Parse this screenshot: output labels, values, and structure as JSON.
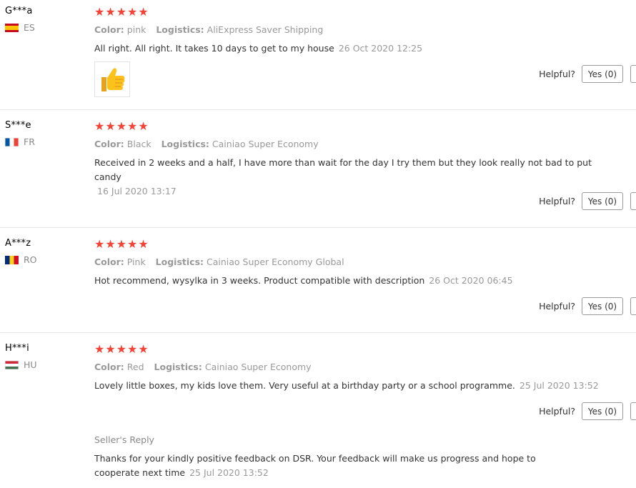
{
  "reviews": [
    {
      "user": "G***a",
      "country": "ES",
      "stars": "★★★★★",
      "color_label": "Color:",
      "color_value": "pink",
      "logistics_label": "Logistics:",
      "logistics_value": "AliExpress Saver Shipping",
      "text": "All right. All right. It takes 10 days to get to my house",
      "date": "26 Oct 2020 12:25",
      "helpful_label": "Helpful?",
      "yes_label": "Yes (0)",
      "photo_icon": "thumbs-up-icon"
    },
    {
      "user": "S***e",
      "country": "FR",
      "stars": "★★★★★",
      "color_label": "Color:",
      "color_value": "Black",
      "logistics_label": "Logistics:",
      "logistics_value": "Cainiao Super Economy",
      "text": "Received in 2 weeks and a half, I have more than wait for the day I try them but they look really not bad to put candy",
      "date": "16 Jul 2020 13:17",
      "helpful_label": "Helpful?",
      "yes_label": "Yes (0)"
    },
    {
      "user": "A***z",
      "country": "RO",
      "stars": "★★★★★",
      "color_label": "Color:",
      "color_value": "Pink",
      "logistics_label": "Logistics:",
      "logistics_value": "Cainiao Super Economy Global",
      "text": "Hot recommend, wysylka in 3 weeks. Product compatible with description",
      "date": "26 Oct 2020 06:45",
      "helpful_label": "Helpful?",
      "yes_label": "Yes (0)"
    },
    {
      "user": "H***i",
      "country": "HU",
      "stars": "★★★★★",
      "color_label": "Color:",
      "color_value": "Red",
      "logistics_label": "Logistics:",
      "logistics_value": "Cainiao Super Economy",
      "text": "Lovely little boxes, my kids love them. Very useful at a birthday party or a school programme.",
      "date": "25 Jul 2020 13:52",
      "helpful_label": "Helpful?",
      "yes_label": "Yes (0)",
      "seller_reply": {
        "title": "Seller's Reply",
        "text": "Thanks for your kindly positive feedback on DSR. Your feedback will make us progress and hope to cooperate next time",
        "date": "25 Jul 2020 13:52"
      }
    }
  ],
  "colors": {
    "stars": "#f44336",
    "muted": "#999999",
    "text": "#333333"
  }
}
